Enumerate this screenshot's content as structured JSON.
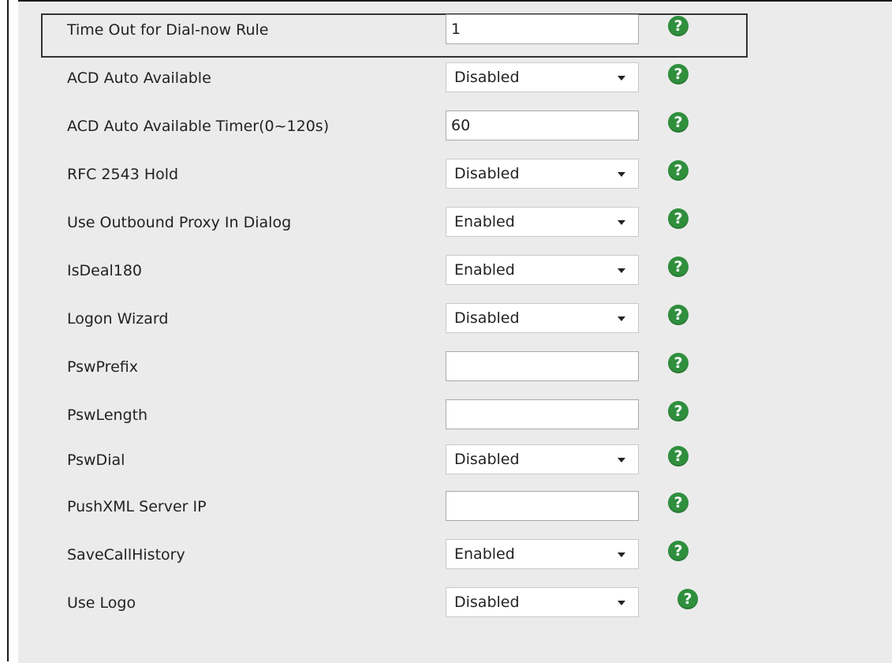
{
  "settings": [
    {
      "label": "Time Out for Dial-now Rule",
      "type": "input",
      "value": "1"
    },
    {
      "label": "ACD Auto Available",
      "type": "select",
      "value": "Disabled"
    },
    {
      "label": "ACD Auto Available Timer(0~120s)",
      "type": "input",
      "value": "60"
    },
    {
      "label": "RFC 2543 Hold",
      "type": "select",
      "value": "Disabled"
    },
    {
      "label": "Use Outbound Proxy In Dialog",
      "type": "select",
      "value": "Enabled"
    },
    {
      "label": "IsDeal180",
      "type": "select",
      "value": "Enabled"
    },
    {
      "label": "Logon Wizard",
      "type": "select",
      "value": "Disabled"
    },
    {
      "label": "PswPrefix",
      "type": "input",
      "value": ""
    },
    {
      "label": "PswLength",
      "type": "input",
      "value": ""
    },
    {
      "label": "PswDial",
      "type": "select",
      "value": "Disabled"
    },
    {
      "label": "PushXML Server IP",
      "type": "input",
      "value": ""
    },
    {
      "label": "SaveCallHistory",
      "type": "select",
      "value": "Enabled"
    },
    {
      "label": "Use Logo",
      "type": "select",
      "value": "Disabled"
    }
  ],
  "help_glyph": "?",
  "icons": {
    "help": "help-circle-icon",
    "dropdown": "dropdown-caret-icon"
  },
  "colors": {
    "panel_bg": "#ebebeb",
    "help_icon": "#2f8f3d"
  }
}
